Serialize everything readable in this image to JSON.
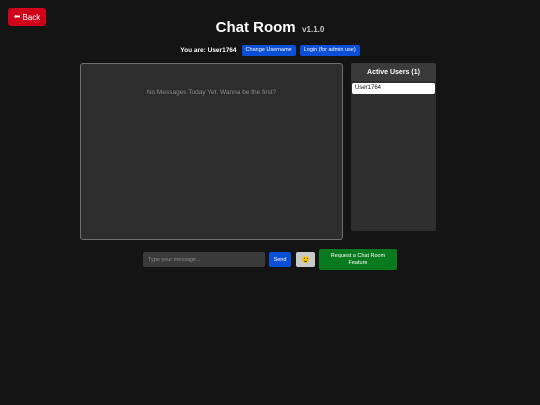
{
  "nav": {
    "back_label": "Back",
    "back_icon": "arrow-left-icon"
  },
  "header": {
    "title": "Chat Room",
    "version": "v1.1.0"
  },
  "user_bar": {
    "label": "You are: User1764",
    "change_username_label": "Change Username",
    "login_label": "Login (for admin use)"
  },
  "chat": {
    "empty_message": "No Messages Today Yet. Wanna be the first?"
  },
  "active_users": {
    "title": "Active Users (1)",
    "users": [
      "User1764"
    ]
  },
  "composer": {
    "placeholder": "Type your message...",
    "value": "",
    "send_label": "Send",
    "emoji_icon": "smiley-face-icon",
    "feature_request_label": "Request a Chat Room Feature"
  },
  "colors": {
    "background": "#141414",
    "back_button": "#d0021b",
    "primary_button": "#0b4fd6",
    "feature_button": "#0a7a1f",
    "panel": "#2d2d2d"
  }
}
